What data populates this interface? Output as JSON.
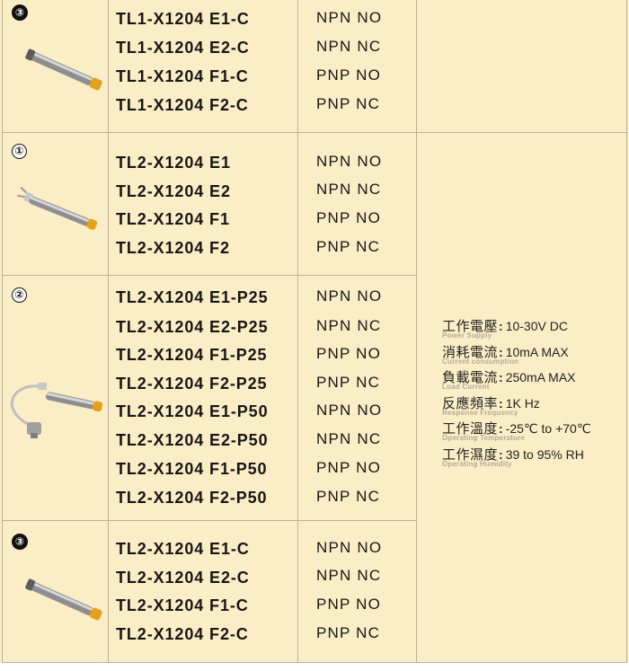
{
  "sections": [
    {
      "marker": "③",
      "models": [
        {
          "model": "TL1-X1204 E1-C",
          "output": "NPN NO"
        },
        {
          "model": "TL1-X1204 E2-C",
          "output": "NPN NC"
        },
        {
          "model": "TL1-X1204 F1-C",
          "output": "PNP NO"
        },
        {
          "model": "TL1-X1204 F2-C",
          "output": "PNP NC"
        }
      ]
    },
    {
      "marker": "①",
      "models": [
        {
          "model": "TL2-X1204 E1",
          "output": "NPN NO"
        },
        {
          "model": "TL2-X1204 E2",
          "output": "NPN NC"
        },
        {
          "model": "TL2-X1204 F1",
          "output": "PNP NO"
        },
        {
          "model": "TL2-X1204 F2",
          "output": "PNP NC"
        }
      ]
    },
    {
      "marker": "②",
      "models": [
        {
          "model": "TL2-X1204 E1-P25",
          "output": "NPN NO"
        },
        {
          "model": "TL2-X1204 E2-P25",
          "output": "NPN NC"
        },
        {
          "model": "TL2-X1204 F1-P25",
          "output": "PNP NO"
        },
        {
          "model": "TL2-X1204 F2-P25",
          "output": "PNP NC"
        },
        {
          "model": "TL2-X1204 E1-P50",
          "output": "NPN NO"
        },
        {
          "model": "TL2-X1204 E2-P50",
          "output": "NPN NC"
        },
        {
          "model": "TL2-X1204 F1-P50",
          "output": "PNP NO"
        },
        {
          "model": "TL2-X1204 F2-P50",
          "output": "PNP NC"
        }
      ]
    },
    {
      "marker": "③",
      "models": [
        {
          "model": "TL2-X1204 E1-C",
          "output": "NPN NO"
        },
        {
          "model": "TL2-X1204 E2-C",
          "output": "NPN NC"
        },
        {
          "model": "TL2-X1204 F1-C",
          "output": "PNP NO"
        },
        {
          "model": "TL2-X1204 F2-C",
          "output": "PNP NC"
        }
      ]
    }
  ],
  "specs": [
    {
      "label": "工作電壓",
      "sub": "Power Supply",
      "value": "10-30V DC"
    },
    {
      "label": "消耗電流",
      "sub": "Current consumption",
      "value": "10mA MAX"
    },
    {
      "label": "負載電流",
      "sub": "Load Current",
      "value": "250mA MAX"
    },
    {
      "label": "反應頻率",
      "sub": "Response Frequency",
      "value": "1K Hz"
    },
    {
      "label": "工作溫度",
      "sub": "Operating Temperature",
      "value": "-25℃ to +70℃"
    },
    {
      "label": "工作濕度",
      "sub": "Operating Humidity",
      "value": "39 to 95% RH"
    }
  ],
  "colors": {
    "background": "#fbeec6",
    "grid": "#b7b0a2",
    "sensor_body": "#8e8e8e",
    "sensor_cap": "#e3a21a"
  }
}
